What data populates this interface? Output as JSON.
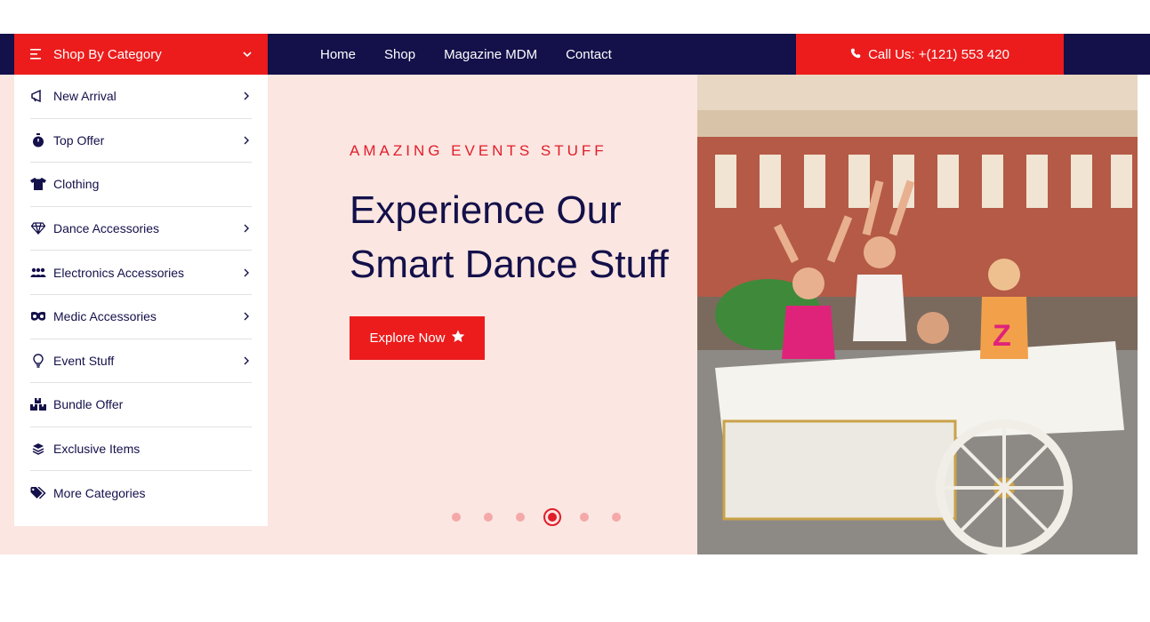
{
  "nav": {
    "category_toggle_label": "Shop By Category",
    "links": [
      "Home",
      "Shop",
      "Magazine MDM",
      "Contact"
    ],
    "call_label": "Call Us: +(121) 553 420"
  },
  "categories": [
    {
      "label": "New Arrival",
      "icon": "megaphone-icon",
      "has_submenu": true
    },
    {
      "label": "Top Offer",
      "icon": "stopwatch-icon",
      "has_submenu": true
    },
    {
      "label": "Clothing",
      "icon": "tshirt-icon",
      "has_submenu": false
    },
    {
      "label": "Dance Accessories",
      "icon": "diamond-icon",
      "has_submenu": true
    },
    {
      "label": "Electronics Accessories",
      "icon": "users-icon",
      "has_submenu": true
    },
    {
      "label": "Medic Accessories",
      "icon": "mask-icon",
      "has_submenu": true
    },
    {
      "label": "Event Stuff",
      "icon": "lightbulb-icon",
      "has_submenu": true
    },
    {
      "label": "Bundle Offer",
      "icon": "boxes-icon",
      "has_submenu": false
    },
    {
      "label": "Exclusive Items",
      "icon": "layers-icon",
      "has_submenu": false
    },
    {
      "label": "More Categories",
      "icon": "tags-icon",
      "has_submenu": false
    }
  ],
  "hero": {
    "eyebrow": "AMAZING EVENTS STUFF",
    "headline": "Experience Our Smart Dance Stuff",
    "cta_label": "Explore Now",
    "slide_count": 6,
    "active_slide": 4
  },
  "colors": {
    "brand_red": "#ec1c1c",
    "navy": "#13104a",
    "hero_bg": "#fbe6e1"
  }
}
